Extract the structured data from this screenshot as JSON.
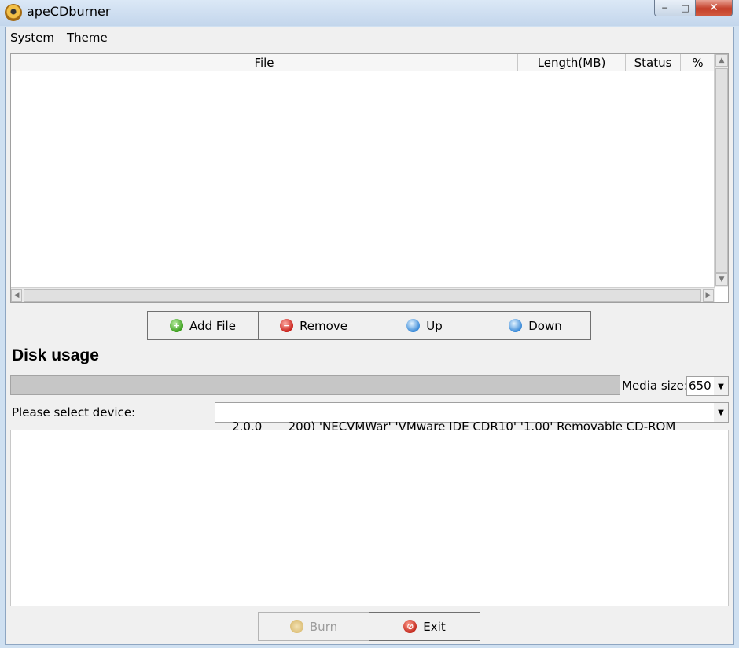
{
  "window": {
    "title": "apeCDburner"
  },
  "menu": {
    "items": [
      "System",
      "Theme"
    ]
  },
  "file_table": {
    "columns": [
      "File",
      "Length(MB)",
      "Status",
      "%"
    ],
    "rows": []
  },
  "actions": {
    "add_file": "Add File",
    "remove": "Remove",
    "up": "Up",
    "down": "Down"
  },
  "disk_usage": {
    "title": "Disk usage",
    "progress": 0,
    "media_size_label": "Media size:",
    "media_size_value": "650"
  },
  "device": {
    "label": "Please select device:",
    "selected": "2,0,0       200) 'NECVMWar' 'VMware IDE CDR10' '1.00' Removable CD-ROM"
  },
  "footer": {
    "burn": "Burn",
    "burn_enabled": false,
    "exit": "Exit"
  },
  "icons": {
    "app": "cd-burner-icon",
    "add": "green-plus-circle-icon",
    "remove": "red-minus-circle-icon",
    "up": "blue-circle-icon",
    "down": "blue-circle-icon",
    "burn": "burn-disc-icon",
    "exit": "red-exit-icon"
  }
}
